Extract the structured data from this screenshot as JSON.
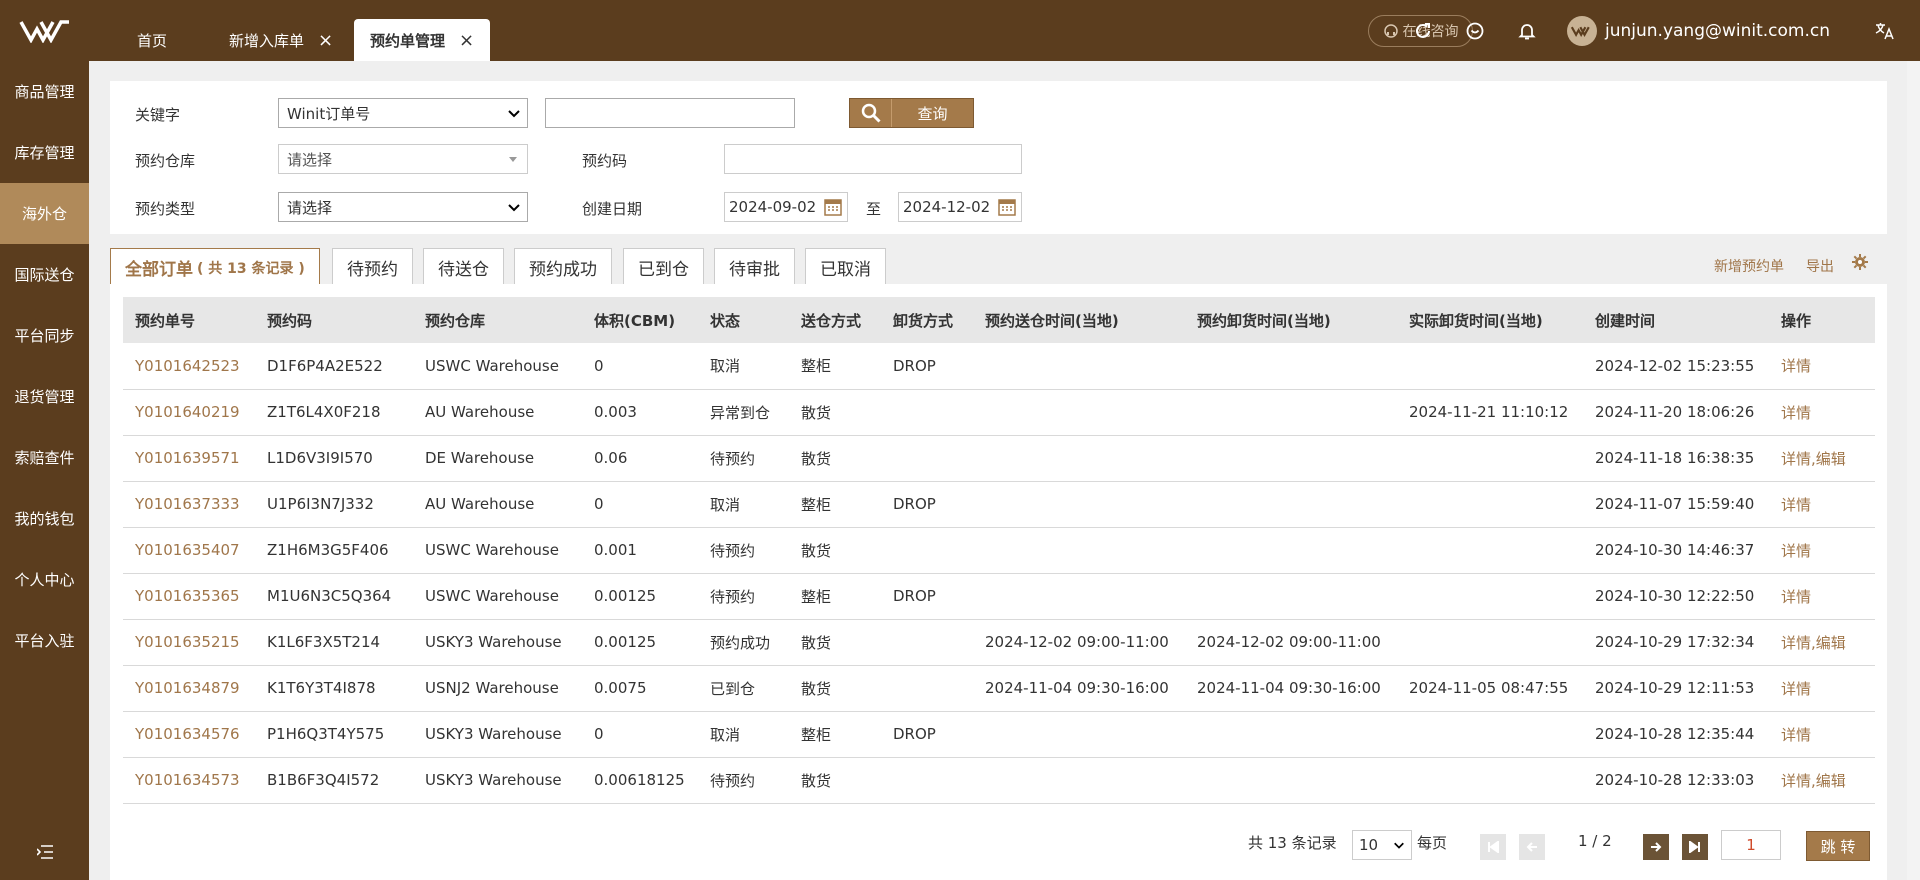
{
  "sidebar": {
    "items": [
      {
        "label": "商品管理"
      },
      {
        "label": "库存管理"
      },
      {
        "label": "海外仓"
      },
      {
        "label": "国际送仓"
      },
      {
        "label": "平台同步"
      },
      {
        "label": "退货管理"
      },
      {
        "label": "索赔查件"
      },
      {
        "label": "我的钱包"
      },
      {
        "label": "个人中心"
      },
      {
        "label": "平台入驻"
      }
    ],
    "active_index": 2
  },
  "topbar": {
    "tabs": [
      {
        "label": "首页"
      },
      {
        "label": "新增入库单",
        "close": "×"
      },
      {
        "label": "预约单管理",
        "close": "×"
      }
    ],
    "consult_label": "在线咨询",
    "user_email": "junjun.yang@winit.com.cn"
  },
  "filters": {
    "keyword_label": "关键字",
    "keyword_type": "Winit订单号",
    "keyword_value": "",
    "search_label": "查询",
    "warehouse_label": "预约仓库",
    "warehouse_value": "请选择",
    "code_label": "预约码",
    "code_value": "",
    "type_label": "预约类型",
    "type_value": "请选择",
    "date_label": "创建日期",
    "date_from": "2024-09-02",
    "date_to_sep": "至",
    "date_to": "2024-12-02"
  },
  "status_tabs": [
    {
      "label": "全部订单",
      "count": "( 共 13 条记录 )"
    },
    {
      "label": "待预约"
    },
    {
      "label": "待送仓"
    },
    {
      "label": "预约成功"
    },
    {
      "label": "已到仓"
    },
    {
      "label": "待审批"
    },
    {
      "label": "已取消"
    }
  ],
  "actions": {
    "add": "新增预约单",
    "export": "导出"
  },
  "table": {
    "headers": [
      "预约单号",
      "预约码",
      "预约仓库",
      "体积(CBM)",
      "状态",
      "送仓方式",
      "卸货方式",
      "预约送仓时间(当地)",
      "预约卸货时间(当地)",
      "实际卸货时间(当地)",
      "创建时间",
      "操作"
    ],
    "rows": [
      {
        "no": "Y0101642523",
        "code": "D1F6P4A2E522",
        "wh": "USWC Warehouse",
        "vol": "0",
        "status": "取消",
        "send": "整柜",
        "unload": "DROP",
        "t1": "",
        "t2": "",
        "t3": "",
        "created": "2024-12-02 15:23:55",
        "op": "详情",
        "op2": ""
      },
      {
        "no": "Y0101640219",
        "code": "Z1T6L4X0F218",
        "wh": "AU Warehouse",
        "vol": "0.003",
        "status": "异常到仓",
        "send": "散货",
        "unload": "",
        "t1": "",
        "t2": "",
        "t3": "2024-11-21 11:10:12",
        "created": "2024-11-20 18:06:26",
        "op": "详情",
        "op2": ""
      },
      {
        "no": "Y0101639571",
        "code": "L1D6V3I9I570",
        "wh": "DE Warehouse",
        "vol": "0.06",
        "status": "待预约",
        "send": "散货",
        "unload": "",
        "t1": "",
        "t2": "",
        "t3": "",
        "created": "2024-11-18 16:38:35",
        "op": "详情",
        "op2": ",编辑"
      },
      {
        "no": "Y0101637333",
        "code": "U1P6I3N7J332",
        "wh": "AU Warehouse",
        "vol": "0",
        "status": "取消",
        "send": "整柜",
        "unload": "DROP",
        "t1": "",
        "t2": "",
        "t3": "",
        "created": "2024-11-07 15:59:40",
        "op": "详情",
        "op2": ""
      },
      {
        "no": "Y0101635407",
        "code": "Z1H6M3G5F406",
        "wh": "USWC Warehouse",
        "vol": "0.001",
        "status": "待预约",
        "send": "散货",
        "unload": "",
        "t1": "",
        "t2": "",
        "t3": "",
        "created": "2024-10-30 14:46:37",
        "op": "详情",
        "op2": ""
      },
      {
        "no": "Y0101635365",
        "code": "M1U6N3C5Q364",
        "wh": "USWC Warehouse",
        "vol": "0.00125",
        "status": "待预约",
        "send": "整柜",
        "unload": "DROP",
        "t1": "",
        "t2": "",
        "t3": "",
        "created": "2024-10-30 12:22:50",
        "op": "详情",
        "op2": ""
      },
      {
        "no": "Y0101635215",
        "code": "K1L6F3X5T214",
        "wh": "USKY3 Warehouse",
        "vol": "0.00125",
        "status": "预约成功",
        "send": "散货",
        "unload": "",
        "t1": "2024-12-02 09:00-11:00",
        "t2": "2024-12-02 09:00-11:00",
        "t3": "",
        "created": "2024-10-29 17:32:34",
        "op": "详情",
        "op2": ",编辑"
      },
      {
        "no": "Y0101634879",
        "code": "K1T6Y3T4I878",
        "wh": "USNJ2 Warehouse",
        "vol": "0.0075",
        "status": "已到仓",
        "send": "散货",
        "unload": "",
        "t1": "2024-11-04 09:30-16:00",
        "t2": "2024-11-04 09:30-16:00",
        "t3": "2024-11-05 08:47:55",
        "created": "2024-10-29 12:11:53",
        "op": "详情",
        "op2": ""
      },
      {
        "no": "Y0101634576",
        "code": "P1H6Q3T4Y575",
        "wh": "USKY3 Warehouse",
        "vol": "0",
        "status": "取消",
        "send": "整柜",
        "unload": "DROP",
        "t1": "",
        "t2": "",
        "t3": "",
        "created": "2024-10-28 12:35:44",
        "op": "详情",
        "op2": ""
      },
      {
        "no": "Y0101634573",
        "code": "B1B6F3Q4I572",
        "wh": "USKY3 Warehouse",
        "vol": "0.00618125",
        "status": "待预约",
        "send": "散货",
        "unload": "",
        "t1": "",
        "t2": "",
        "t3": "",
        "created": "2024-10-28 12:33:03",
        "op": "详情",
        "op2": ",编辑"
      }
    ]
  },
  "pagination": {
    "total": "共 13 条记录",
    "page_size": "10",
    "per_page_label": "每页",
    "page_info": "1 / 2",
    "jump_value": "1",
    "jump_label": "跳 转"
  },
  "colors": {
    "brand_dark": "#5b3d1e",
    "accent": "#a47a4a",
    "link": "#a0764a"
  }
}
